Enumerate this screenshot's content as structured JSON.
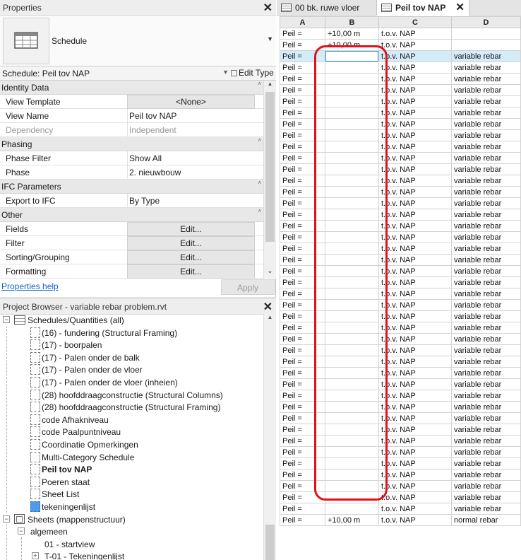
{
  "properties": {
    "title": "Properties",
    "type_name": "Schedule",
    "instance_label": "Schedule: Peil tov NAP",
    "edit_type": "Edit Type",
    "sections": [
      {
        "name": "Identity Data",
        "rows": [
          {
            "key": "View Template",
            "value": "<None>",
            "kind": "button"
          },
          {
            "key": "View Name",
            "value": "Peil tov NAP"
          },
          {
            "key": "Dependency",
            "value": "Independent",
            "disabled": true
          }
        ]
      },
      {
        "name": "Phasing",
        "rows": [
          {
            "key": "Phase Filter",
            "value": "Show All"
          },
          {
            "key": "Phase",
            "value": "2. nieuwbouw"
          }
        ]
      },
      {
        "name": "IFC Parameters",
        "rows": [
          {
            "key": "Export to IFC",
            "value": "By Type"
          }
        ]
      },
      {
        "name": "Other",
        "rows": [
          {
            "key": "Fields",
            "value": "Edit...",
            "kind": "button"
          },
          {
            "key": "Filter",
            "value": "Edit...",
            "kind": "button"
          },
          {
            "key": "Sorting/Grouping",
            "value": "Edit...",
            "kind": "button"
          },
          {
            "key": "Formatting",
            "value": "Edit...",
            "kind": "button"
          }
        ]
      }
    ],
    "help_link": "Properties help",
    "apply": "Apply"
  },
  "project_browser": {
    "title": "Project Browser - variable rebar problem.rvt",
    "nodes": [
      {
        "label": "Schedules/Quantities (all)",
        "level": 0,
        "icon": "schedule-group-icon",
        "expander": "−"
      },
      {
        "label": "(16) - fundering (Structural Framing)",
        "level": 1,
        "icon": "leaf"
      },
      {
        "label": "(17) - boorpalen",
        "level": 1,
        "icon": "leaf"
      },
      {
        "label": "(17) - Palen onder de balk",
        "level": 1,
        "icon": "leaf"
      },
      {
        "label": "(17) - Palen onder de vloer",
        "level": 1,
        "icon": "leaf"
      },
      {
        "label": "(17) - Palen onder de vloer (inheien)",
        "level": 1,
        "icon": "leaf"
      },
      {
        "label": "(28) hoofddraagconstructie (Structural Columns)",
        "level": 1,
        "icon": "leaf"
      },
      {
        "label": "(28) hoofddraagconstructie (Structural Framing)",
        "level": 1,
        "icon": "leaf"
      },
      {
        "label": "code Afhakniveau",
        "level": 1,
        "icon": "leaf"
      },
      {
        "label": "code Paalpuntniveau",
        "level": 1,
        "icon": "leaf"
      },
      {
        "label": "Coordinatie Opmerkingen",
        "level": 1,
        "icon": "leaf"
      },
      {
        "label": "Multi-Category Schedule",
        "level": 1,
        "icon": "leaf"
      },
      {
        "label": "Peil tov NAP",
        "level": 1,
        "icon": "leaf",
        "bold": true
      },
      {
        "label": "Poeren staat",
        "level": 1,
        "icon": "leaf"
      },
      {
        "label": "Sheet List",
        "level": 1,
        "icon": "leaf"
      },
      {
        "label": "tekeningenlijst",
        "level": 1,
        "icon": "leaf-selected"
      },
      {
        "label": "Sheets (mappenstructuur)",
        "level": 0,
        "icon": "sheet-group-icon",
        "expander": "−"
      },
      {
        "label": "algemeen",
        "level": 1,
        "icon": "none",
        "expander": "−"
      },
      {
        "label": "01 - startview",
        "level": 2,
        "icon": "none"
      },
      {
        "label": "T-01 - Tekeningenlijst",
        "level": 2,
        "icon": "none",
        "expander": "+"
      }
    ]
  },
  "tabs": [
    {
      "label": "00 bk. ruwe vloer",
      "active": false
    },
    {
      "label": "Peil tov NAP",
      "active": true
    }
  ],
  "schedule": {
    "columns": [
      "A",
      "B",
      "C",
      "D"
    ],
    "rows": [
      [
        "Peil =",
        "+10,00 m",
        "t.o.v. NAP",
        ""
      ],
      [
        "Peil =",
        "+10,00 m",
        "t.o.v. NAP",
        ""
      ],
      [
        "Peil =",
        "",
        "t.o.v. NAP",
        "variable rebar"
      ],
      [
        "Peil =",
        "",
        "t.o.v. NAP",
        "variable rebar"
      ],
      [
        "Peil =",
        "",
        "t.o.v. NAP",
        "variable rebar"
      ],
      [
        "Peil =",
        "",
        "t.o.v. NAP",
        "variable rebar"
      ],
      [
        "Peil =",
        "",
        "t.o.v. NAP",
        "variable rebar"
      ],
      [
        "Peil =",
        "",
        "t.o.v. NAP",
        "variable rebar"
      ],
      [
        "Peil =",
        "",
        "t.o.v. NAP",
        "variable rebar"
      ],
      [
        "Peil =",
        "",
        "t.o.v. NAP",
        "variable rebar"
      ],
      [
        "Peil =",
        "",
        "t.o.v. NAP",
        "variable rebar"
      ],
      [
        "Peil =",
        "",
        "t.o.v. NAP",
        "variable rebar"
      ],
      [
        "Peil =",
        "",
        "t.o.v. NAP",
        "variable rebar"
      ],
      [
        "Peil =",
        "",
        "t.o.v. NAP",
        "variable rebar"
      ],
      [
        "Peil =",
        "",
        "t.o.v. NAP",
        "variable rebar"
      ],
      [
        "Peil =",
        "",
        "t.o.v. NAP",
        "variable rebar"
      ],
      [
        "Peil =",
        "",
        "t.o.v. NAP",
        "variable rebar"
      ],
      [
        "Peil =",
        "",
        "t.o.v. NAP",
        "variable rebar"
      ],
      [
        "Peil =",
        "",
        "t.o.v. NAP",
        "variable rebar"
      ],
      [
        "Peil =",
        "",
        "t.o.v. NAP",
        "variable rebar"
      ],
      [
        "Peil =",
        "",
        "t.o.v. NAP",
        "variable rebar"
      ],
      [
        "Peil =",
        "",
        "t.o.v. NAP",
        "variable rebar"
      ],
      [
        "Peil =",
        "",
        "t.o.v. NAP",
        "variable rebar"
      ],
      [
        "Peil =",
        "",
        "t.o.v. NAP",
        "variable rebar"
      ],
      [
        "Peil =",
        "",
        "t.o.v. NAP",
        "variable rebar"
      ],
      [
        "Peil =",
        "",
        "t.o.v. NAP",
        "variable rebar"
      ],
      [
        "Peil =",
        "",
        "t.o.v. NAP",
        "variable rebar"
      ],
      [
        "Peil =",
        "",
        "t.o.v. NAP",
        "variable rebar"
      ],
      [
        "Peil =",
        "",
        "t.o.v. NAP",
        "variable rebar"
      ],
      [
        "Peil =",
        "",
        "t.o.v. NAP",
        "variable rebar"
      ],
      [
        "Peil =",
        "",
        "t.o.v. NAP",
        "variable rebar"
      ],
      [
        "Peil =",
        "",
        "t.o.v. NAP",
        "variable rebar"
      ],
      [
        "Peil =",
        "",
        "t.o.v. NAP",
        "variable rebar"
      ],
      [
        "Peil =",
        "",
        "t.o.v. NAP",
        "variable rebar"
      ],
      [
        "Peil =",
        "",
        "t.o.v. NAP",
        "variable rebar"
      ],
      [
        "Peil =",
        "",
        "t.o.v. NAP",
        "variable rebar"
      ],
      [
        "Peil =",
        "",
        "t.o.v. NAP",
        "variable rebar"
      ],
      [
        "Peil =",
        "",
        "t.o.v. NAP",
        "variable rebar"
      ],
      [
        "Peil =",
        "",
        "t.o.v. NAP",
        "variable rebar"
      ],
      [
        "Peil =",
        "",
        "t.o.v. NAP",
        "variable rebar"
      ],
      [
        "Peil =",
        "",
        "t.o.v. NAP",
        "variable rebar"
      ],
      [
        "Peil =",
        "",
        "t.o.v. NAP",
        "variable rebar"
      ],
      [
        "Peil =",
        "",
        "t.o.v. NAP",
        "variable rebar"
      ],
      [
        "Peil =",
        "+10,00 m",
        "t.o.v. NAP",
        "normal rebar"
      ]
    ],
    "selected_row": 2,
    "annotation_color": "#e0121b"
  }
}
